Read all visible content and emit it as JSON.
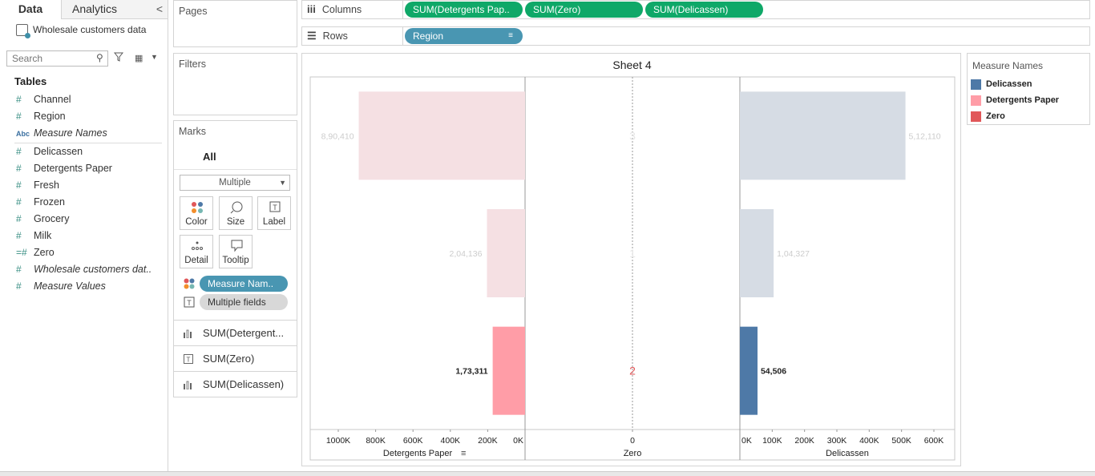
{
  "data_pane": {
    "tabs": {
      "data": "Data",
      "analytics": "Analytics",
      "collapse": "<"
    },
    "datasource": "Wholesale customers data",
    "search_placeholder": "Search",
    "tables_heading": "Tables",
    "fields": [
      {
        "label": "Channel",
        "type": "measure",
        "italic": false
      },
      {
        "label": "Region",
        "type": "measure",
        "italic": false
      },
      {
        "label": "Measure Names",
        "type": "dimension",
        "italic": true
      },
      {
        "label": "Delicassen",
        "type": "measure",
        "italic": false
      },
      {
        "label": "Detergents Paper",
        "type": "measure",
        "italic": false
      },
      {
        "label": "Fresh",
        "type": "measure",
        "italic": false
      },
      {
        "label": "Frozen",
        "type": "measure",
        "italic": false
      },
      {
        "label": "Grocery",
        "type": "measure",
        "italic": false
      },
      {
        "label": "Milk",
        "type": "measure",
        "italic": false
      },
      {
        "label": "Zero",
        "type": "calc",
        "italic": false
      },
      {
        "label": "Wholesale customers dat..",
        "type": "measure",
        "italic": true
      },
      {
        "label": "Measure Values",
        "type": "measure",
        "italic": true
      }
    ]
  },
  "cards": {
    "pages": "Pages",
    "filters": "Filters",
    "marks": {
      "title": "Marks",
      "all": "All",
      "mark_type": "Multiple",
      "buttons": [
        "Color",
        "Size",
        "Label",
        "Detail",
        "Tooltip"
      ],
      "pills": [
        {
          "label": "Measure Nam..",
          "style": "blue",
          "icon": "color-dots-icon"
        },
        {
          "label": "Multiple fields",
          "style": "gray",
          "icon": "label-icon"
        }
      ],
      "measure_tabs": [
        {
          "label": "SUM(Detergent...",
          "icon": "bar-chart-icon"
        },
        {
          "label": "SUM(Zero)",
          "icon": "label-icon"
        },
        {
          "label": "SUM(Delicassen)",
          "icon": "bar-chart-icon"
        }
      ]
    }
  },
  "shelves": {
    "columns": {
      "label": "Columns",
      "pills": [
        "SUM(Detergents Pap..",
        "SUM(Zero)",
        "SUM(Delicassen)"
      ]
    },
    "rows": {
      "label": "Rows",
      "pills": [
        "Region"
      ]
    }
  },
  "sheet": {
    "title": "Sheet 4"
  },
  "legend": {
    "title": "Measure Names",
    "items": [
      {
        "label": "Delicassen",
        "color": "#4e79a7"
      },
      {
        "label": "Detergents Paper",
        "color": "#ff9da7"
      },
      {
        "label": "Zero",
        "color": "#e15759"
      }
    ]
  },
  "chart_data": {
    "type": "bar",
    "rows": [
      {
        "region": "3",
        "detergents_paper": 890410,
        "zero": 0,
        "delicassen": 512110,
        "highlighted": false,
        "labels": {
          "detergents_paper": "8,90,410",
          "zero": "3",
          "delicassen": "5,12,110"
        }
      },
      {
        "region": "1",
        "detergents_paper": 204136,
        "zero": 0,
        "delicassen": 104327,
        "highlighted": false,
        "labels": {
          "detergents_paper": "2,04,136",
          "zero": "1",
          "delicassen": "1,04,327"
        }
      },
      {
        "region": "2",
        "detergents_paper": 173311,
        "zero": 0,
        "delicassen": 54506,
        "highlighted": true,
        "labels": {
          "detergents_paper": "1,73,311",
          "zero": "2",
          "delicassen": "54,506"
        }
      }
    ],
    "panes": [
      {
        "measure": "Detergents Paper",
        "xlabel": "Detergents Paper",
        "reversed": true,
        "xlim": [
          0,
          1000000
        ],
        "ticks": [
          1000000,
          800000,
          600000,
          400000,
          200000,
          0
        ],
        "tick_labels": [
          "1000K",
          "800K",
          "600K",
          "400K",
          "200K",
          "0K"
        ]
      },
      {
        "measure": "Zero",
        "xlabel": "Zero",
        "ticks": [
          0
        ],
        "tick_labels": [
          "0"
        ]
      },
      {
        "measure": "Delicassen",
        "xlabel": "Delicassen",
        "reversed": false,
        "xlim": [
          0,
          600000
        ],
        "ticks": [
          0,
          100000,
          200000,
          300000,
          400000,
          500000,
          600000
        ],
        "tick_labels": [
          "0K",
          "100K",
          "200K",
          "300K",
          "400K",
          "500K",
          "600K"
        ]
      }
    ],
    "colors": {
      "detergents_paper": "#ff9da7",
      "detergents_paper_faded": "#f5e0e3",
      "delicassen": "#4e79a7",
      "delicassen_faded": "#d6dce4",
      "zero": "#e15759",
      "zero_faded": "#e6e6e6"
    }
  }
}
